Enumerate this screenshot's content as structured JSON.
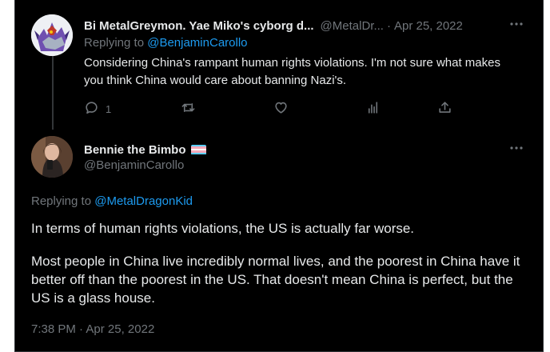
{
  "reply_tweet": {
    "display_name": "Bi MetalGreymon. Yae Miko's cyborg d...",
    "handle": "@MetalDr...",
    "separator": "·",
    "date": "Apr 25, 2022",
    "more_icon": "more-horizontal-icon",
    "replying_prefix": "Replying to",
    "replying_to": "@BenjaminCarollo",
    "text": "Considering China's rampant human rights violations. I'm not sure what makes you think China would care about banning Nazi's.",
    "actions": {
      "reply_icon": "reply-icon",
      "reply_count": "1",
      "retweet_icon": "retweet-icon",
      "like_icon": "heart-icon",
      "views_icon": "views-icon",
      "share_icon": "share-icon"
    }
  },
  "main_tweet": {
    "display_name": "Bennie the Bimbo",
    "flag_icon": "transgender-flag-icon",
    "handle": "@BenjaminCarollo",
    "more_icon": "more-horizontal-icon",
    "replying_prefix": "Replying to",
    "replying_to": "@MetalDragonKid",
    "paragraphs": [
      "In terms of human rights violations, the US is actually far worse.",
      "Most people in China live incredibly normal lives, and the poorest in China have it better off than the poorest in the US. That doesn't mean China is perfect, but the US is a glass house."
    ],
    "time": "7:38 PM",
    "separator": "·",
    "date": "Apr 25, 2022"
  },
  "colors": {
    "background": "#000000",
    "text": "#e7e9ea",
    "secondary": "#71767b",
    "link": "#1d9bf0",
    "flag_blue": "#5bcefa",
    "flag_pink": "#f5a9b8",
    "flag_white": "#ffffff"
  }
}
